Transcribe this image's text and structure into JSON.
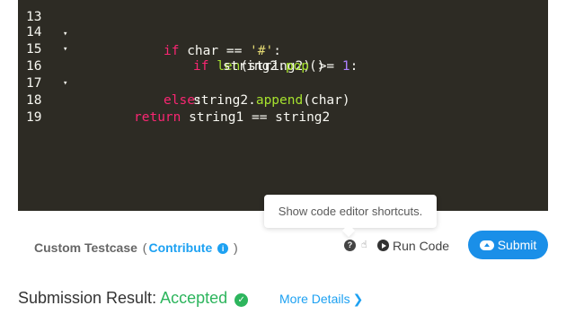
{
  "editor": {
    "lines": [
      {
        "num": "13",
        "fold": "▾"
      },
      {
        "num": "14",
        "fold": "▾"
      },
      {
        "num": "15",
        "fold": ""
      },
      {
        "num": "16",
        "fold": "▾"
      },
      {
        "num": "17",
        "fold": ""
      },
      {
        "num": "18",
        "fold": ""
      },
      {
        "num": "19",
        "fold": ""
      }
    ],
    "code": {
      "l13_kw": "if",
      "l13_rest": " char == ",
      "l13_str": "'#'",
      "l13_end": ":",
      "l14_kw": "if",
      "l14_fn": "len",
      "l14_mid": "(string2) >= ",
      "l14_num": "1",
      "l14_end": ":",
      "l15_a": "string2.",
      "l15_fn": "pop",
      "l15_b": "()",
      "l16_kw": "else",
      "l16_end": ":",
      "l17_a": "string2.",
      "l17_fn": "append",
      "l17_b": "(char)",
      "l18_kw": "return",
      "l18_rest": " string1 == string2"
    }
  },
  "tooltip": {
    "text": "Show code editor shortcuts."
  },
  "testcase": {
    "label": "Custom Testcase",
    "open_paren": "(",
    "contribute": "Contribute",
    "close_paren": ")"
  },
  "toolbar": {
    "run_label": "Run Code",
    "submit_label": "Submit"
  },
  "result": {
    "label": "Submission Result:",
    "status": "Accepted",
    "status_color": "#2db55d",
    "more_details": "More Details"
  },
  "icons": {
    "shortcut": "question-circle-icon",
    "cursor": "hand-pointer-icon",
    "run": "play-circle-icon",
    "submit": "cloud-upload-icon",
    "contribute": "info-circle-icon",
    "accepted": "check-circle-icon",
    "more": "chevron-right-icon"
  }
}
